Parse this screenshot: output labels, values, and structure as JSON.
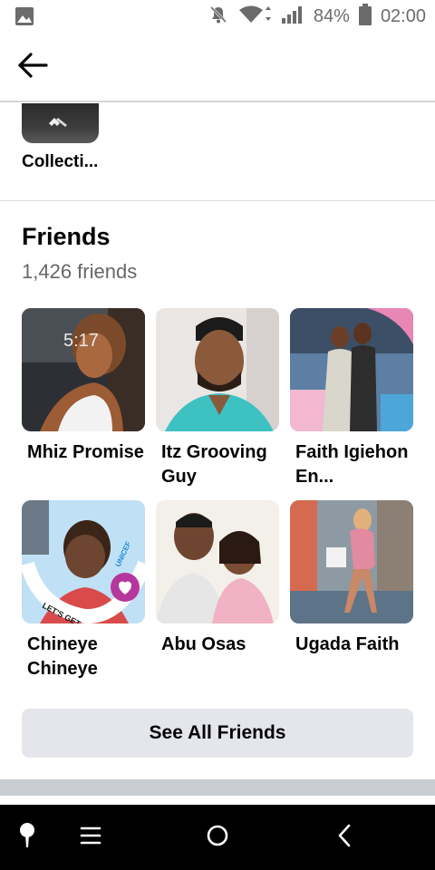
{
  "status_bar": {
    "battery": "84%",
    "time": "02:00",
    "icons": [
      "gallery-icon",
      "mute-icon",
      "wifi-icon",
      "signal-icon",
      "battery-icon"
    ]
  },
  "app_bar": {
    "back_icon": "arrow-left-icon"
  },
  "collections": {
    "label": "Collecti..."
  },
  "friends": {
    "title": "Friends",
    "count": "1,426 friends",
    "items": [
      {
        "name": "Mhiz Promise"
      },
      {
        "name": "Itz Grooving Guy"
      },
      {
        "name": "Faith Igiehon En..."
      },
      {
        "name": "Chineye Chineye"
      },
      {
        "name": "Abu Osas"
      },
      {
        "name": "Ugada Faith"
      }
    ],
    "photo_overlays": {
      "lockscreen_time": "5:17",
      "vaccinated_banner": "LET'S GET VACCINATED",
      "unicef": "UNICEF"
    },
    "see_all_label": "See All Friends"
  },
  "nav_bar": {
    "icons": [
      "pin-icon",
      "menu-icon",
      "home-icon",
      "back-icon"
    ]
  }
}
